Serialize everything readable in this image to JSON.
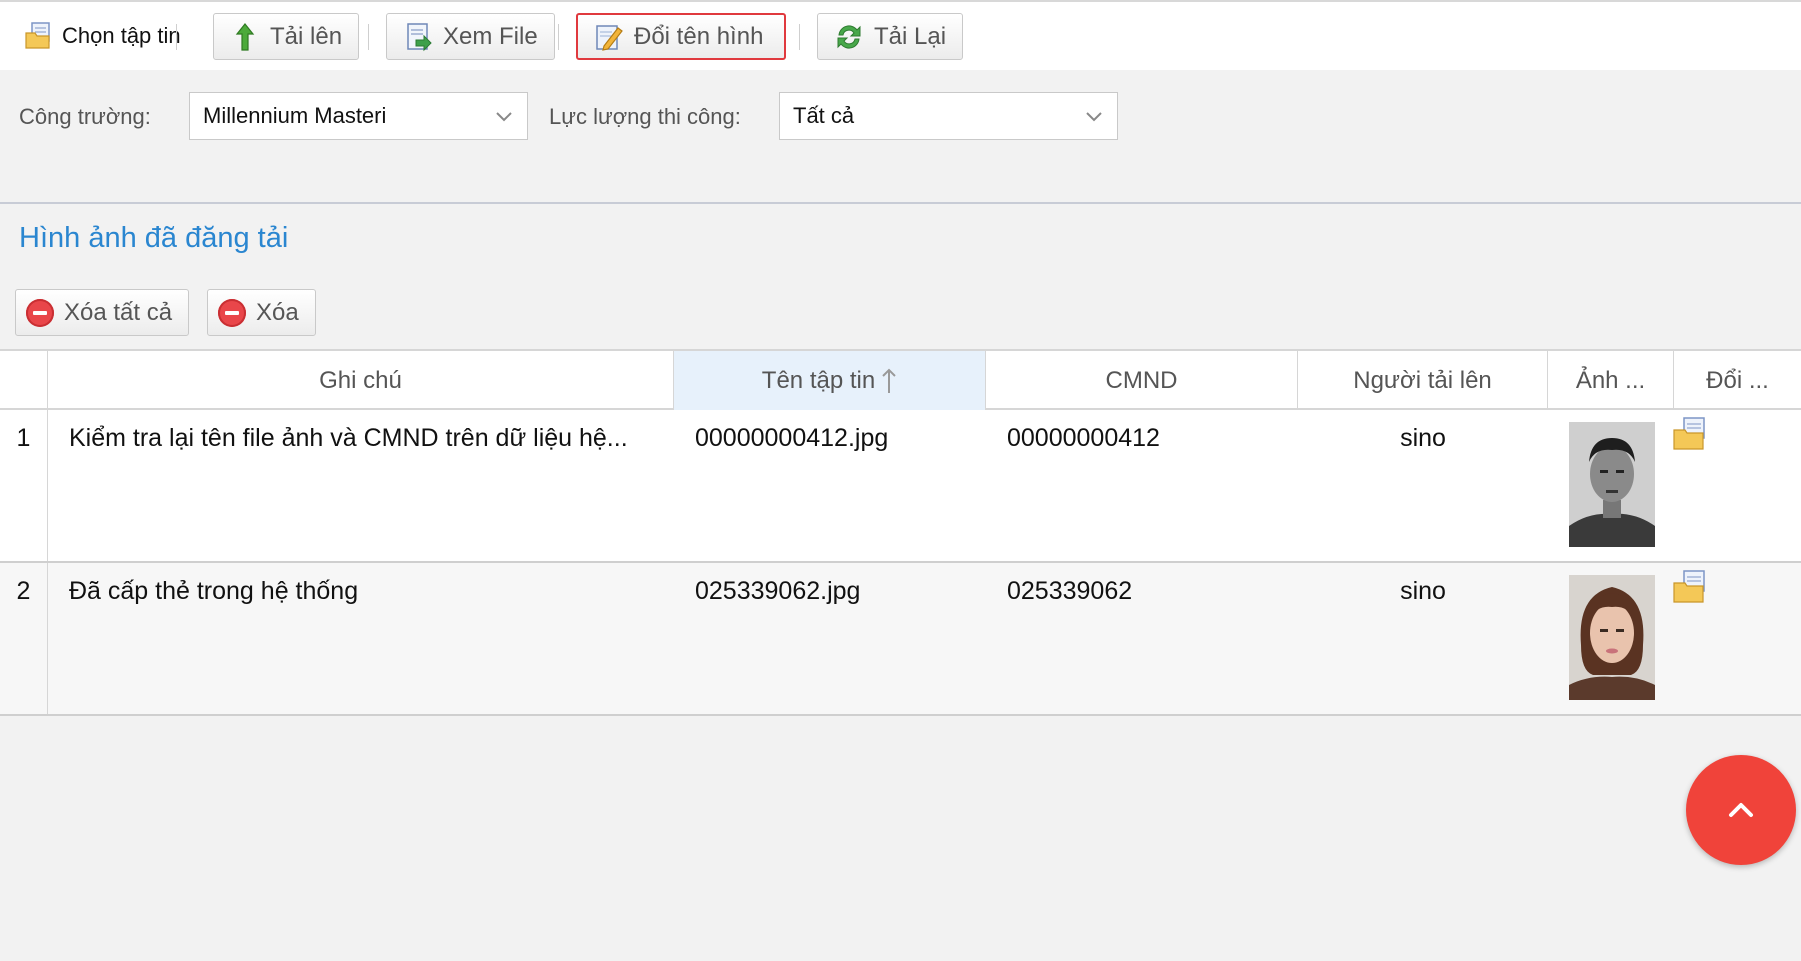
{
  "toolbar": {
    "choose_file": "Chọn tập tin",
    "upload": "Tải lên",
    "view_file": "Xem File",
    "rename_image": "Đổi tên hình",
    "reload": "Tải Lại"
  },
  "filters": {
    "site_label": "Công trường:",
    "site_value": "Millennium Masteri",
    "force_label": "Lực lượng thi công:",
    "force_value": "Tất cả"
  },
  "section_title": "Hình ảnh đã đăng tải",
  "actions": {
    "delete_all": "Xóa tất cả",
    "delete": "Xóa"
  },
  "grid": {
    "columns": [
      "Ghi chú",
      "Tên tập tin",
      "CMND",
      "Người tải lên",
      "Ảnh ...",
      "Đổi ..."
    ],
    "sorted_column": "Tên tập tin",
    "rows": [
      {
        "num": "1",
        "note": "Kiểm tra lại tên file ảnh và CMND trên dữ liệu hệ...",
        "filename": "00000000412.jpg",
        "cmnd": "00000000412",
        "uploader": "sino"
      },
      {
        "num": "2",
        "note": "Đã cấp thẻ trong hệ thống",
        "filename": "025339062.jpg",
        "cmnd": "025339062",
        "uploader": "sino"
      }
    ]
  },
  "icons": {
    "choose_file": "folder-icon",
    "upload": "up-arrow-icon",
    "view_file": "view-file-icon",
    "rename": "edit-icon",
    "reload": "refresh-icon",
    "delete": "minus-circle-icon",
    "scroll_top": "chevron-up-icon"
  },
  "colors": {
    "accent_blue": "#2a86d0",
    "selected_border": "#e0393e",
    "fab_red": "#f0433a",
    "delete_red": "#e9464a"
  }
}
